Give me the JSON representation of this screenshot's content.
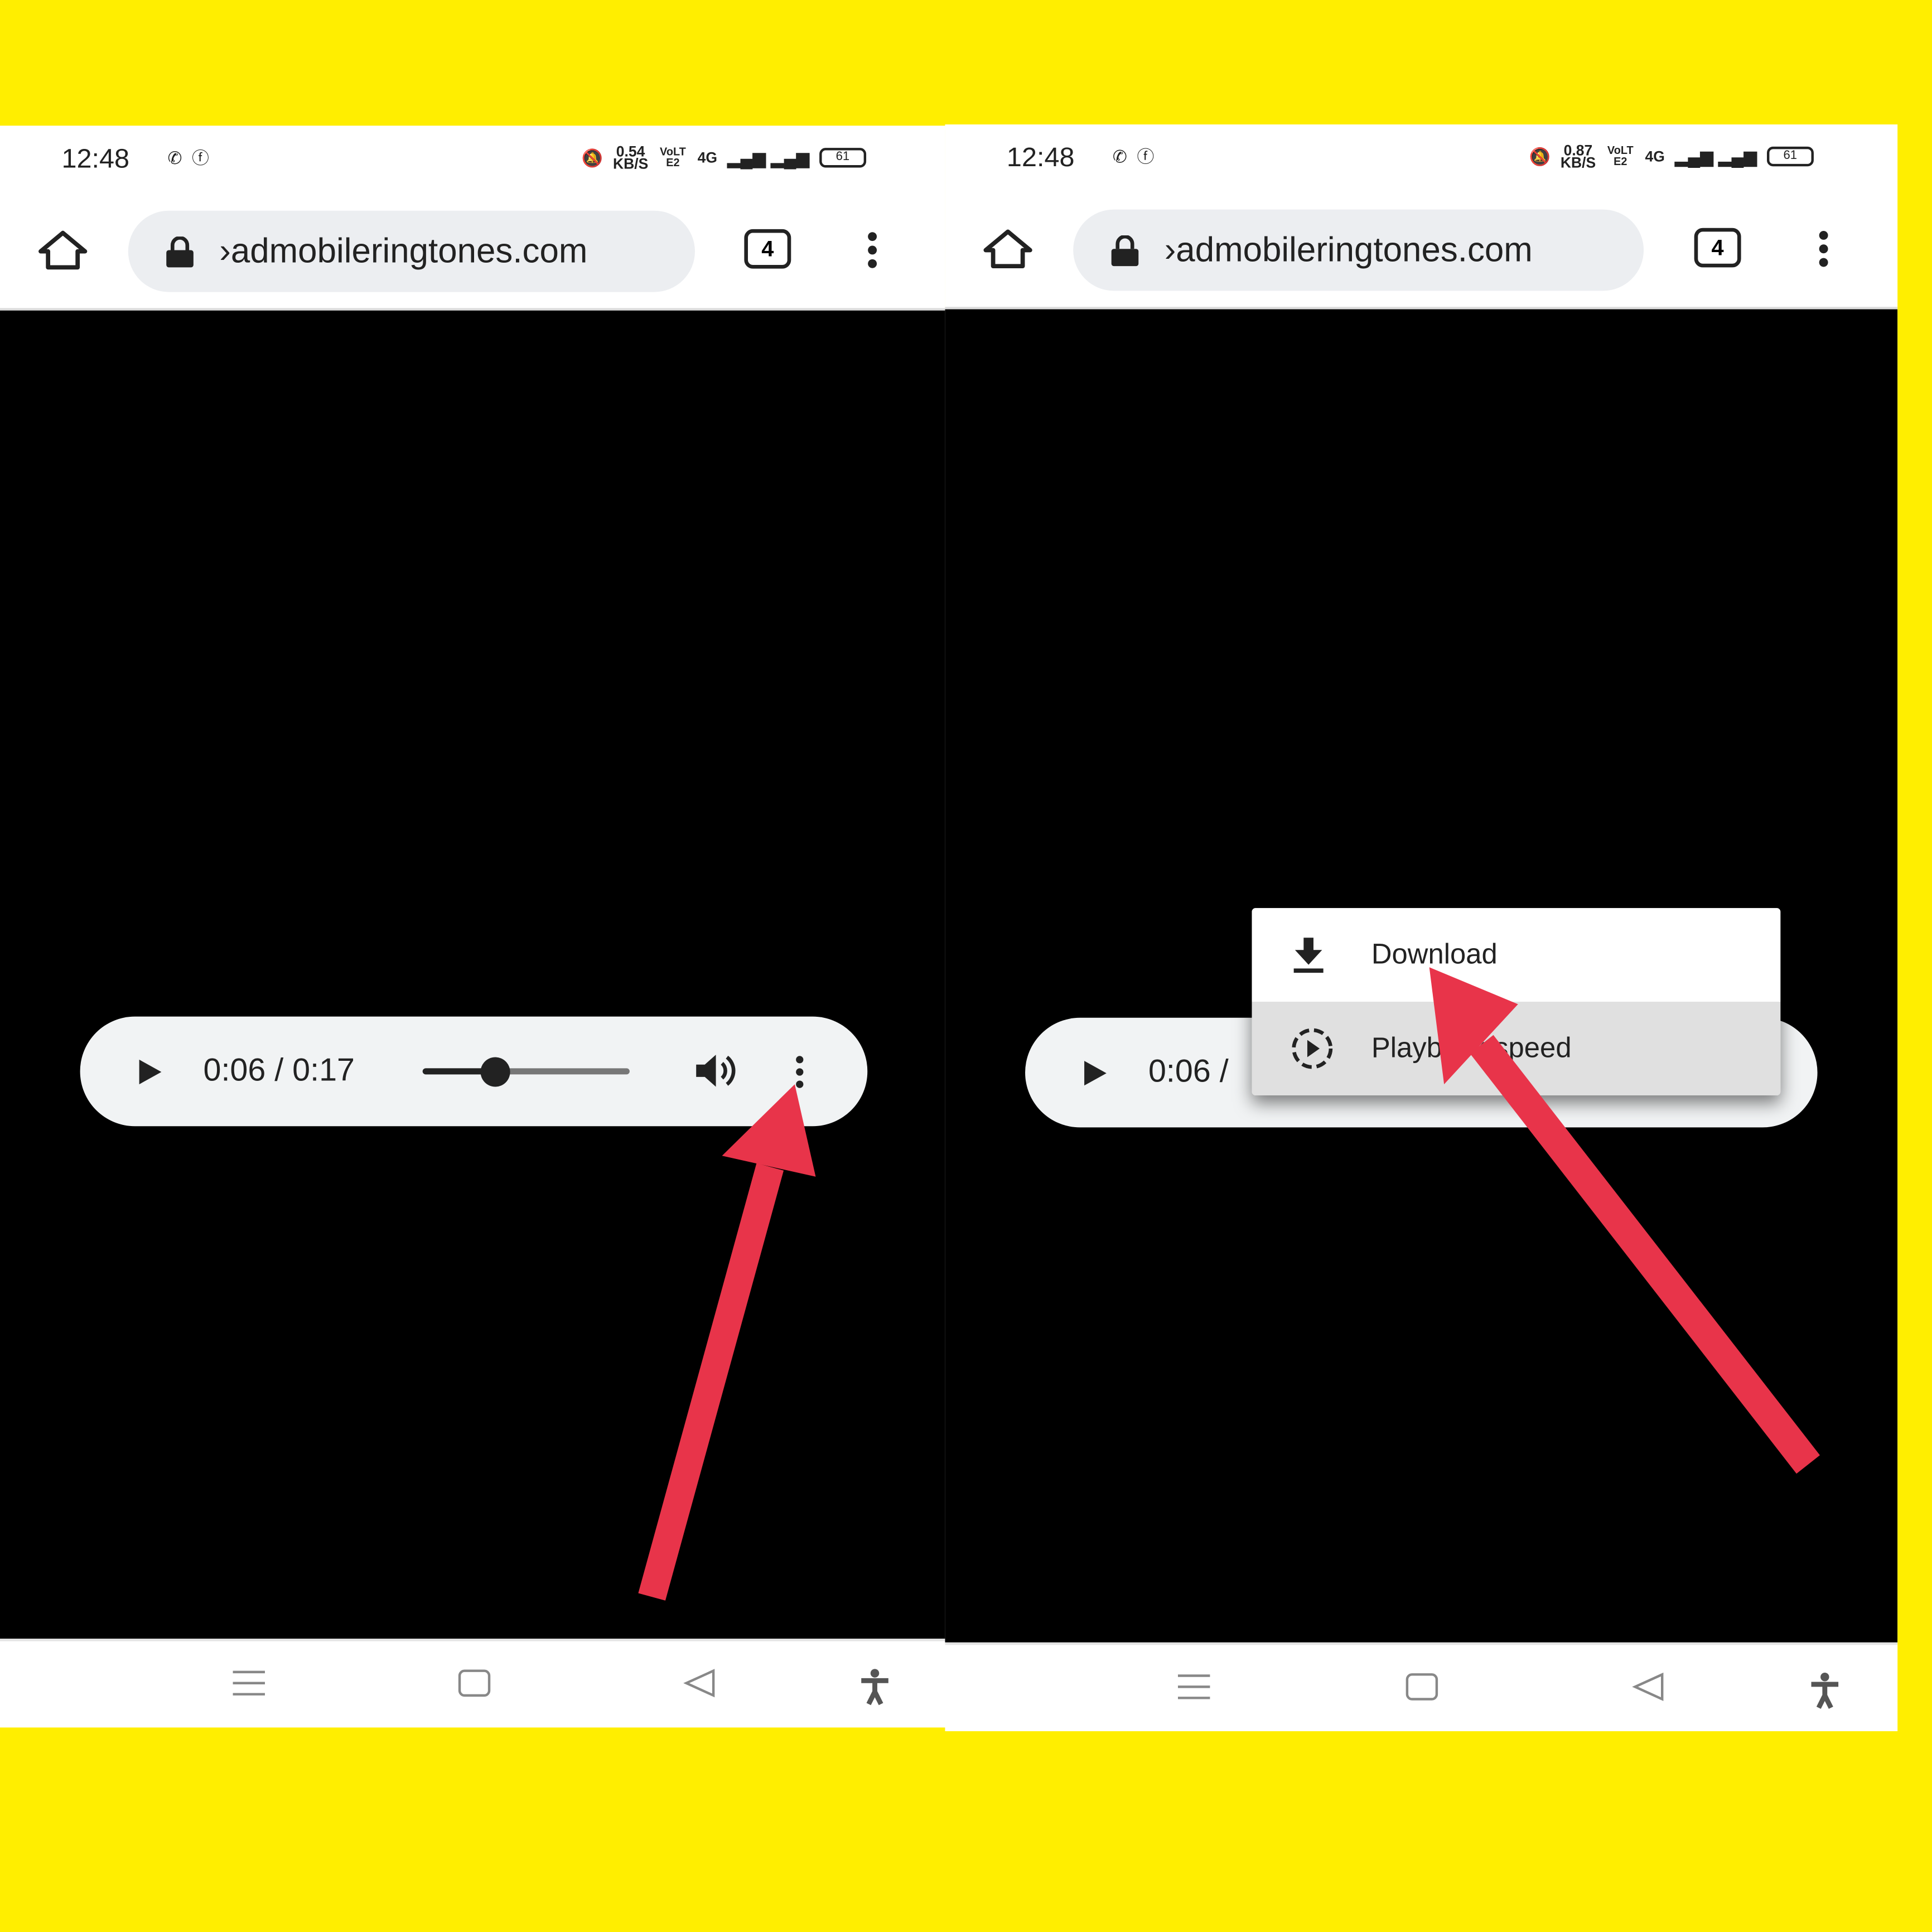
{
  "colors": {
    "background": "#FFEE00",
    "arrow": "#E8344A",
    "content": "#000000"
  },
  "left": {
    "status": {
      "time": "12:48",
      "speed_value": "0.54",
      "speed_unit": "KB/S",
      "volte": "VoLTE2",
      "network": "4G",
      "battery": "61"
    },
    "toolbar": {
      "url": "›admobileringtones.com",
      "tab_count": "4"
    },
    "player": {
      "time": "0:06 / 0:17",
      "progress_fraction": 0.353
    }
  },
  "right": {
    "status": {
      "time": "12:48",
      "speed_value": "0.87",
      "speed_unit": "KB/S",
      "volte": "VoLTE2",
      "network": "4G",
      "battery": "61"
    },
    "toolbar": {
      "url": "›admobileringtones.com",
      "tab_count": "4"
    },
    "player": {
      "time": "0:06 /"
    },
    "menu": {
      "items": [
        {
          "label": "Download",
          "icon": "download-icon"
        },
        {
          "label": "Playback speed",
          "icon": "playback-speed-icon"
        }
      ]
    }
  }
}
